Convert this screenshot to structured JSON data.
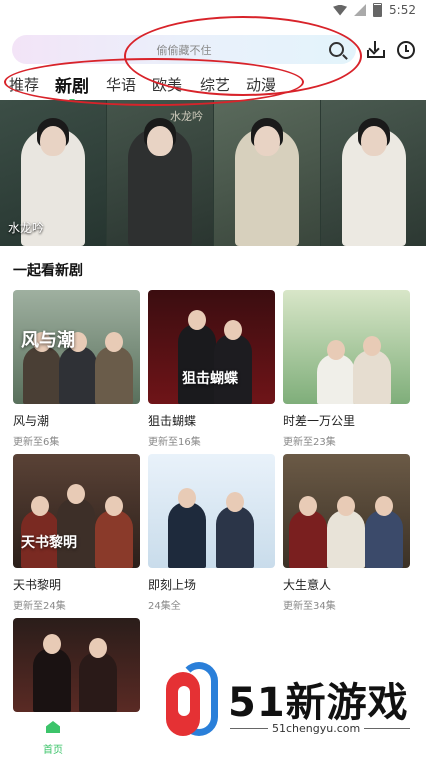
{
  "status_bar": {
    "time": "5:52"
  },
  "header": {
    "search_placeholder": "偷偷藏不住",
    "icons": [
      "search-icon",
      "download-icon",
      "history-icon"
    ]
  },
  "tabs": [
    {
      "label": "推荐",
      "active": false
    },
    {
      "label": "新剧",
      "active": true
    },
    {
      "label": "华语",
      "active": false
    },
    {
      "label": "欧美",
      "active": false
    },
    {
      "label": "综艺",
      "active": false
    },
    {
      "label": "动漫",
      "active": false
    }
  ],
  "banner": {
    "caption": "水龙吟",
    "calligraphy": "水龙吟"
  },
  "section": {
    "title": "一起看新剧",
    "cards": [
      {
        "name": "风与潮",
        "ep": "更新至6集",
        "poster_title": "风与潮"
      },
      {
        "name": "狙击蝴蝶",
        "ep": "更新至16集",
        "poster_title": "狙击蝴蝶"
      },
      {
        "name": "时差一万公里",
        "ep": "更新至23集",
        "poster_title": ""
      },
      {
        "name": "天书黎明",
        "ep": "更新至24集",
        "poster_title": "天书黎明"
      },
      {
        "name": "即刻上场",
        "ep": "24集全",
        "poster_title": ""
      },
      {
        "name": "大生意人",
        "ep": "更新至34集",
        "poster_title": ""
      }
    ]
  },
  "bottom_nav": {
    "home_label": "首页"
  },
  "watermark": {
    "brand": "51新游戏",
    "url": "51chengyu.com"
  },
  "colors": {
    "accent": "#3cc46a",
    "annotation": "#d8232a"
  }
}
